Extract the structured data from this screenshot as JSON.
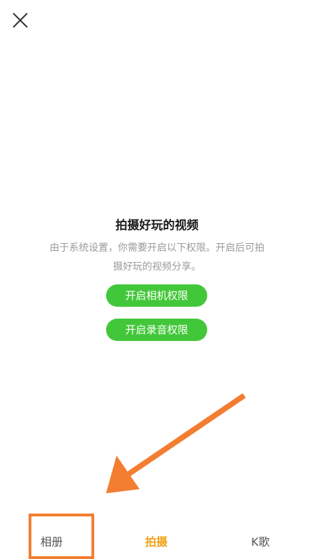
{
  "header": {
    "close_icon": "close-icon"
  },
  "main": {
    "title": "拍摄好玩的视频",
    "description": "由于系统设置，你需要开启以下权限。开启后可拍摄好玩的视频分享。",
    "camera_button_label": "开启相机权限",
    "audio_button_label": "开启录音权限"
  },
  "tabs": [
    {
      "label": "相册",
      "active": false
    },
    {
      "label": "拍摄",
      "active": true
    },
    {
      "label": "K歌",
      "active": false
    }
  ],
  "colors": {
    "accent_green": "#43c73a",
    "active_tab": "#f0a21a",
    "annotation": "#f37d30"
  }
}
